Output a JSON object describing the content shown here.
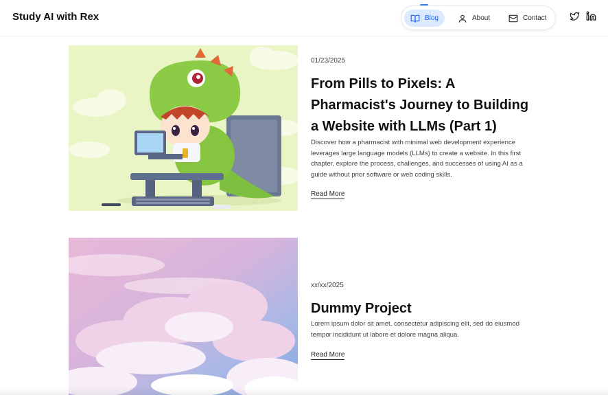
{
  "site": {
    "title": "Study AI with Rex"
  },
  "nav": {
    "items": [
      {
        "label": "Blog",
        "icon": "book-open-icon",
        "active": true
      },
      {
        "label": "About",
        "icon": "user-icon",
        "active": false
      },
      {
        "label": "Contact",
        "icon": "mail-icon",
        "active": false
      }
    ]
  },
  "social": [
    "twitter-icon",
    "linkedin-icon"
  ],
  "posts": [
    {
      "date": "01/23/2025",
      "title": "From Pills to Pixels: A Pharmacist's Journey to Building a Website with LLMs (Part 1)",
      "description": "Discover how a pharmacist with minimal web development experience leverages large language models (LLMs) to create a website. In this first chapter, explore the process, challenges, and successes of using AI as a guide without prior software or web coding skills.",
      "link": "Read More",
      "image": "cartoon-dinosaur-coder"
    },
    {
      "date": "xx/xx/2025",
      "title": "Dummy Project",
      "description": "Lorem ipsum dolor sit amet, consectetur adipiscing elit, sed do eiusmod tempor incididunt ut labore et dolore magna aliqua.",
      "link": "Read More",
      "image": "pastel-clouds"
    }
  ],
  "colors": {
    "accent": "#2563eb",
    "accent_bg": "#dbeafe",
    "text": "#111111",
    "muted": "#3f3f46"
  }
}
